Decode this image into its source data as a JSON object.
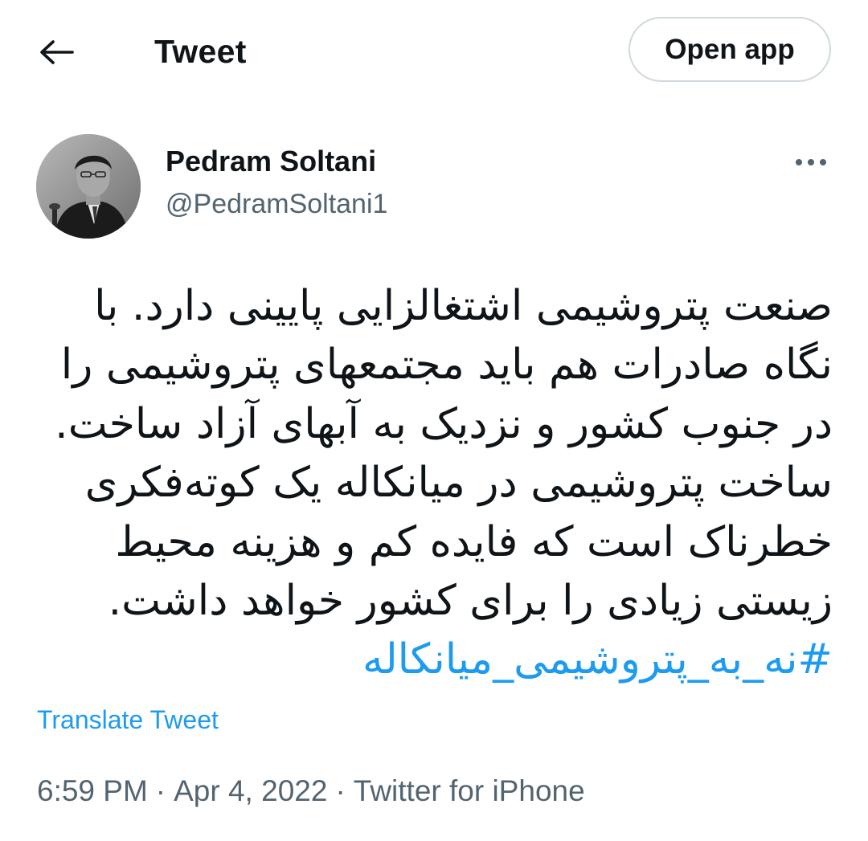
{
  "header": {
    "back_icon": "arrow-left-icon",
    "title": "Tweet",
    "open_app_label": "Open app"
  },
  "author": {
    "avatar_icon": "profile-photo",
    "name": "Pedram Soltani",
    "handle": "@PedramSoltani1",
    "more_icon": "more-horizontal-icon"
  },
  "tweet": {
    "lines": [
      "صنعت پتروشیمی اشتغالزایی پایینی دارد. با",
      "نگاه صادرات هم باید مجتمعهای پتروشیمی را",
      "در جنوب کشور و نزدیک به آبهای آزاد ساخت.",
      "ساخت پتروشیمی در میانکاله یک کوته‌فکری",
      "خطرناک است که فایده کم و هزینه محیط",
      "زیستی زیادی را برای کشور خواهد داشت."
    ],
    "hashtag": "#نه_به_پتروشیمی_میانکاله",
    "translate_label": "Translate Tweet"
  },
  "meta": {
    "time": "6:59 PM",
    "separator": "·",
    "date": "Apr 4, 2022",
    "source": "Twitter for iPhone"
  },
  "colors": {
    "text": "#0f1419",
    "secondary": "#536471",
    "link": "#1d9bf0",
    "border": "#cfd9de"
  }
}
